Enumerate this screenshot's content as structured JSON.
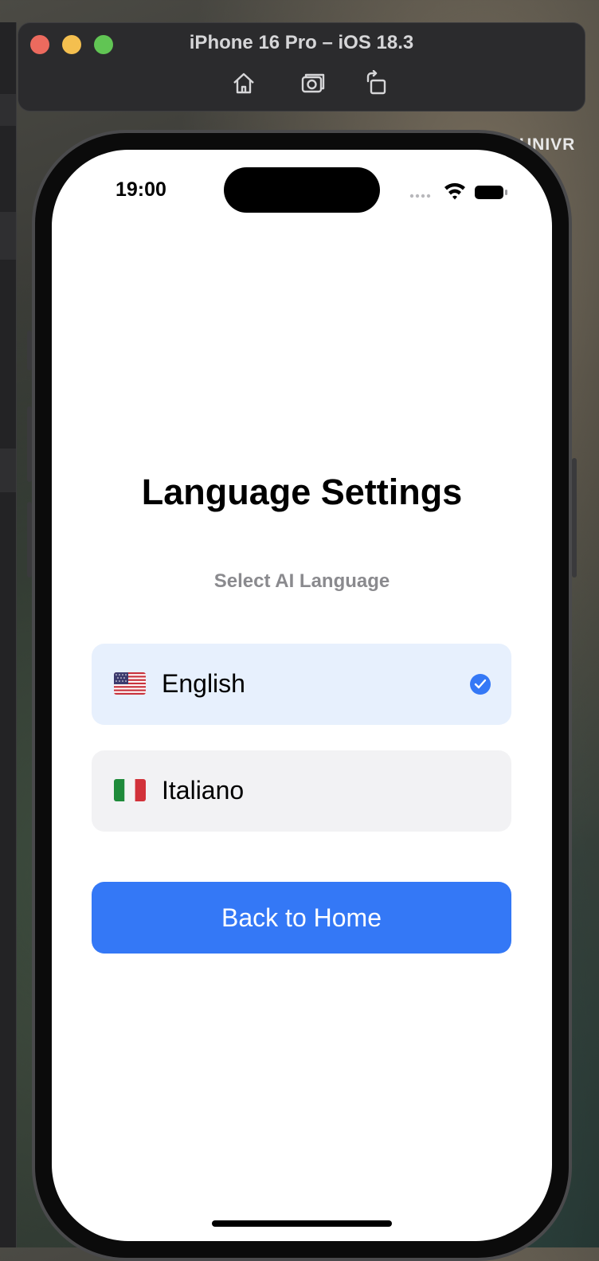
{
  "simulator": {
    "title": "iPhone 16 Pro – iOS 18.3",
    "toolbar_icons": [
      "home-icon",
      "screenshot-icon",
      "rotate-icon"
    ]
  },
  "background_label": "UNIVR",
  "status_bar": {
    "time": "19:00",
    "icons": [
      "cellular-icon",
      "wifi-icon",
      "battery-icon"
    ]
  },
  "screen": {
    "title": "Language Settings",
    "subtitle": "Select AI Language",
    "options": [
      {
        "label": "English",
        "flag": "us-flag-icon",
        "selected": true
      },
      {
        "label": "Italiano",
        "flag": "italy-flag-icon",
        "selected": false
      }
    ],
    "back_button": "Back to Home"
  },
  "colors": {
    "accent": "#3478f6",
    "selected_bg": "#e7f0fd",
    "option_bg": "#f2f2f4",
    "subtitle": "#8a8a8e"
  }
}
